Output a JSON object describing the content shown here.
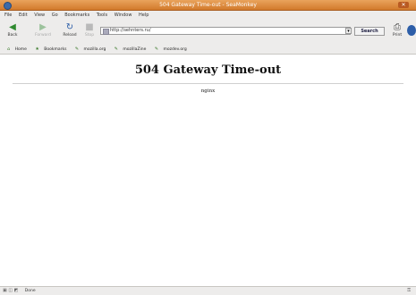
{
  "window": {
    "title": "504 Gateway Time-out - SeaMonkey",
    "close_glyph": "✕"
  },
  "menu": [
    "File",
    "Edit",
    "View",
    "Go",
    "Bookmarks",
    "Tools",
    "Window",
    "Help"
  ],
  "toolbar": {
    "back_label": "Back",
    "forward_label": "Forward",
    "reload_label": "Reload",
    "stop_label": "Stop",
    "url": "http://​sehnters.ru/",
    "search_label": "Search",
    "print_label": "Print"
  },
  "bookmarks": [
    "Home",
    "Bookmarks",
    "mozilla.org",
    "mozillaZine",
    "mozdev.org"
  ],
  "page": {
    "heading": "504 Gateway Time-out",
    "server": "nginx"
  },
  "status": {
    "text": "Done"
  }
}
